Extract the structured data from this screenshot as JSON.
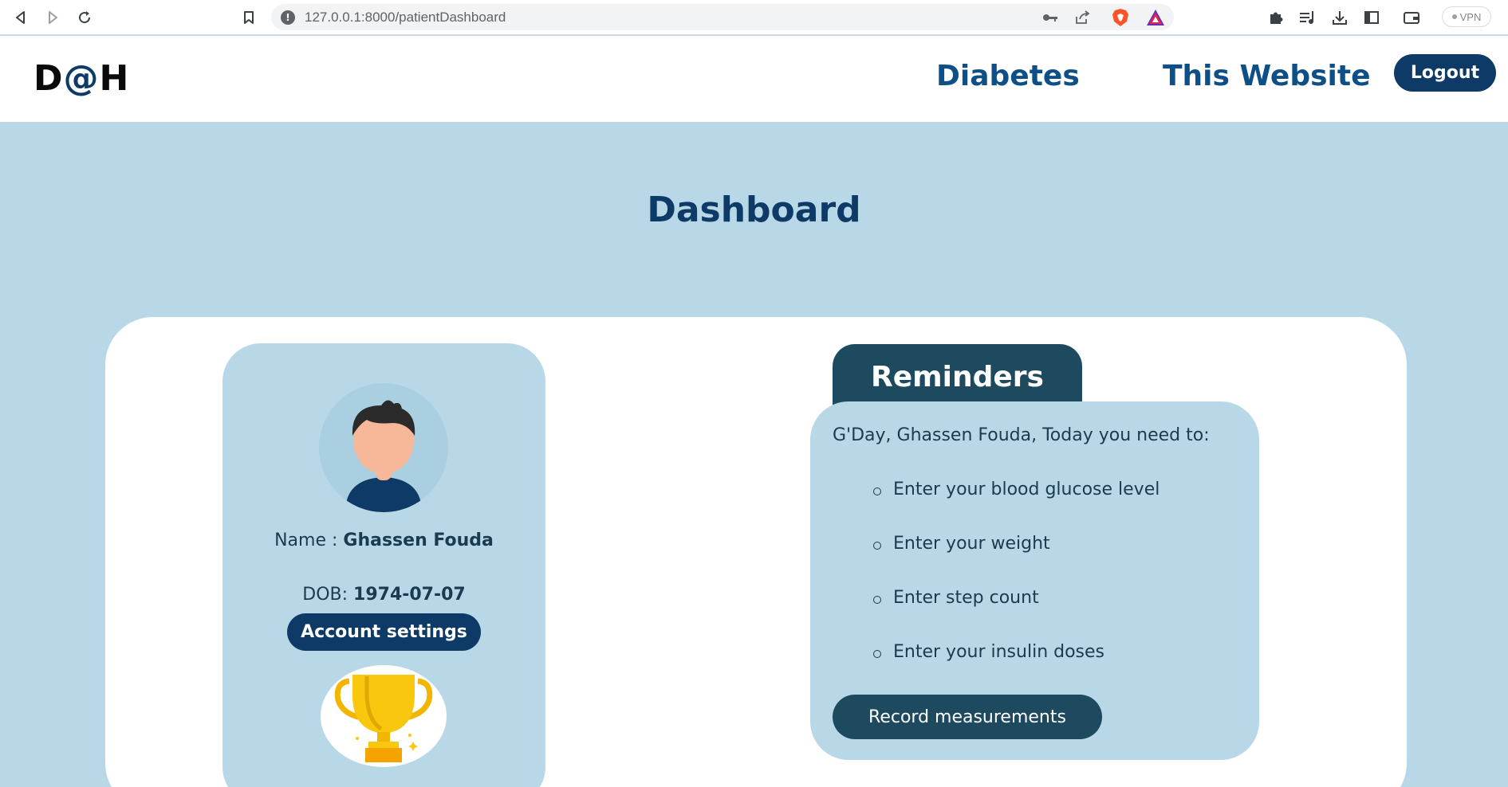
{
  "browser": {
    "url": "127.0.0.1:8000/patientDashboard",
    "vpn_label": "VPN"
  },
  "header": {
    "logo_left": "D",
    "logo_at": "@",
    "logo_right": "H",
    "nav": [
      "Diabetes",
      "This Website"
    ],
    "logout_label": "Logout"
  },
  "main": {
    "title": "Dashboard"
  },
  "profile": {
    "name_label": "Name : ",
    "name_value": "Ghassen Fouda",
    "dob_label": "DOB: ",
    "dob_value": "1974-07-07",
    "account_button": "Account settings"
  },
  "reminders": {
    "tab_label": "Reminders",
    "greeting": "G'Day, Ghassen Fouda, Today you need to:",
    "tasks": [
      "Enter your blood glucose level",
      "Enter your weight",
      "Enter step count",
      "Enter your insulin doses"
    ],
    "record_button": "Record measurements"
  },
  "colors": {
    "navy": "#0d3a66",
    "teal": "#1e4a60",
    "light_blue": "#b8d8e8"
  }
}
